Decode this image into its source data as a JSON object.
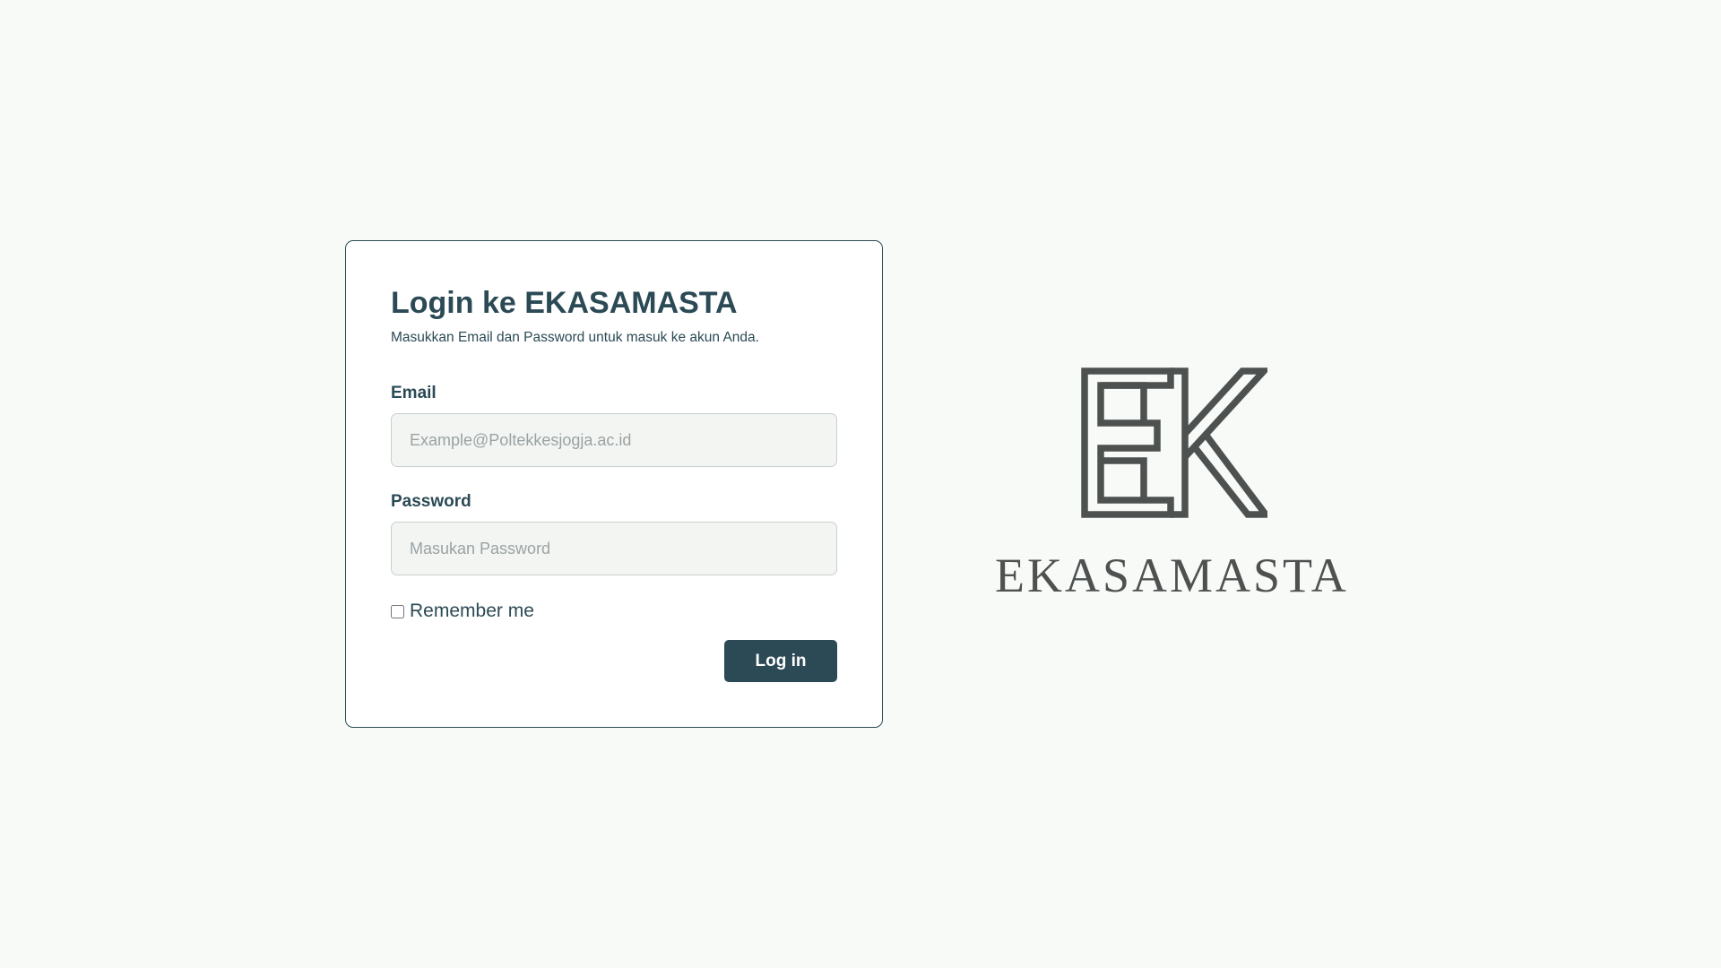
{
  "login": {
    "title": "Login ke EKASAMASTA",
    "subtitle": "Masukkan Email dan Password untuk masuk ke akun Anda.",
    "email": {
      "label": "Email",
      "value": "",
      "placeholder": "Example@Poltekkesjogja.ac.id"
    },
    "password": {
      "label": "Password",
      "value": "",
      "placeholder": "Masukan Password"
    },
    "remember_me": {
      "label": "Remember me",
      "checked": false
    },
    "submit_label": "Log in"
  },
  "brand": {
    "name": "EKASAMASTA",
    "logo_icon": "ek-monogram-logo"
  },
  "colors": {
    "background": "#f8faf8",
    "primary": "#2c4a55",
    "logo": "#4d5250"
  }
}
